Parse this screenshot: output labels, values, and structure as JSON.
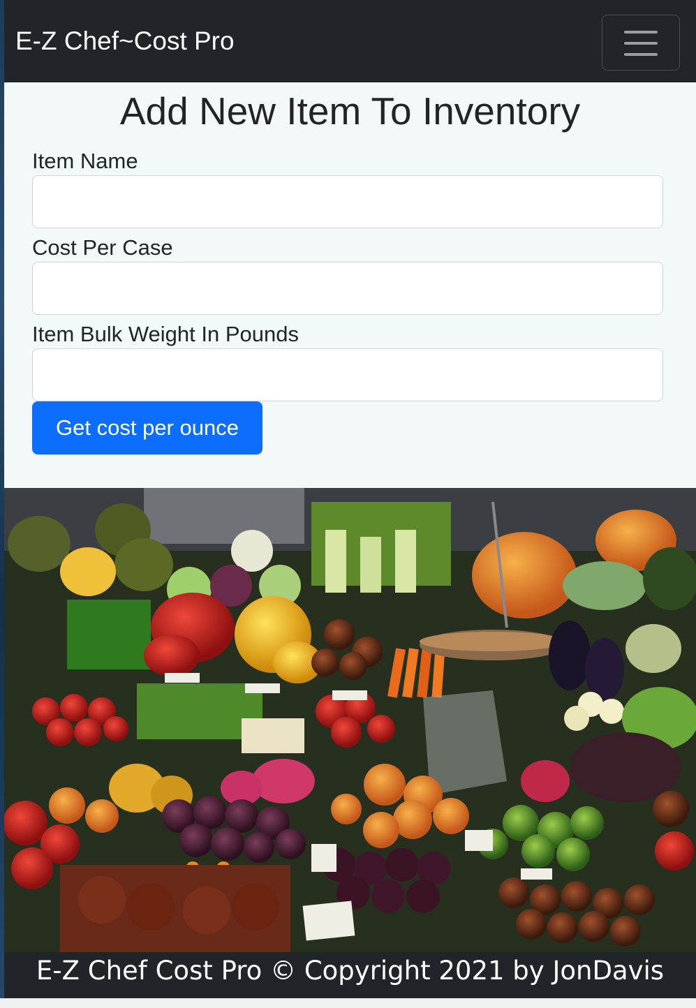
{
  "navbar": {
    "brand": "E-Z Chef~Cost Pro",
    "menu_icon": "hamburger-menu-icon"
  },
  "form": {
    "title": "Add New Item To Inventory",
    "fields": [
      {
        "label": "Item Name",
        "value": "",
        "placeholder": ""
      },
      {
        "label": "Cost Per Case",
        "value": "",
        "placeholder": ""
      },
      {
        "label": "Item Bulk Weight In Pounds",
        "value": "",
        "placeholder": ""
      }
    ],
    "submit_label": "Get cost per ounce"
  },
  "footer": {
    "text": "E-Z Chef Cost Pro © Copyright 2021 by JonDavis"
  },
  "colors": {
    "navbar_bg": "#212529",
    "form_bg": "#f3f8f8",
    "primary_button": "#0d6efd",
    "text": "#212529"
  }
}
